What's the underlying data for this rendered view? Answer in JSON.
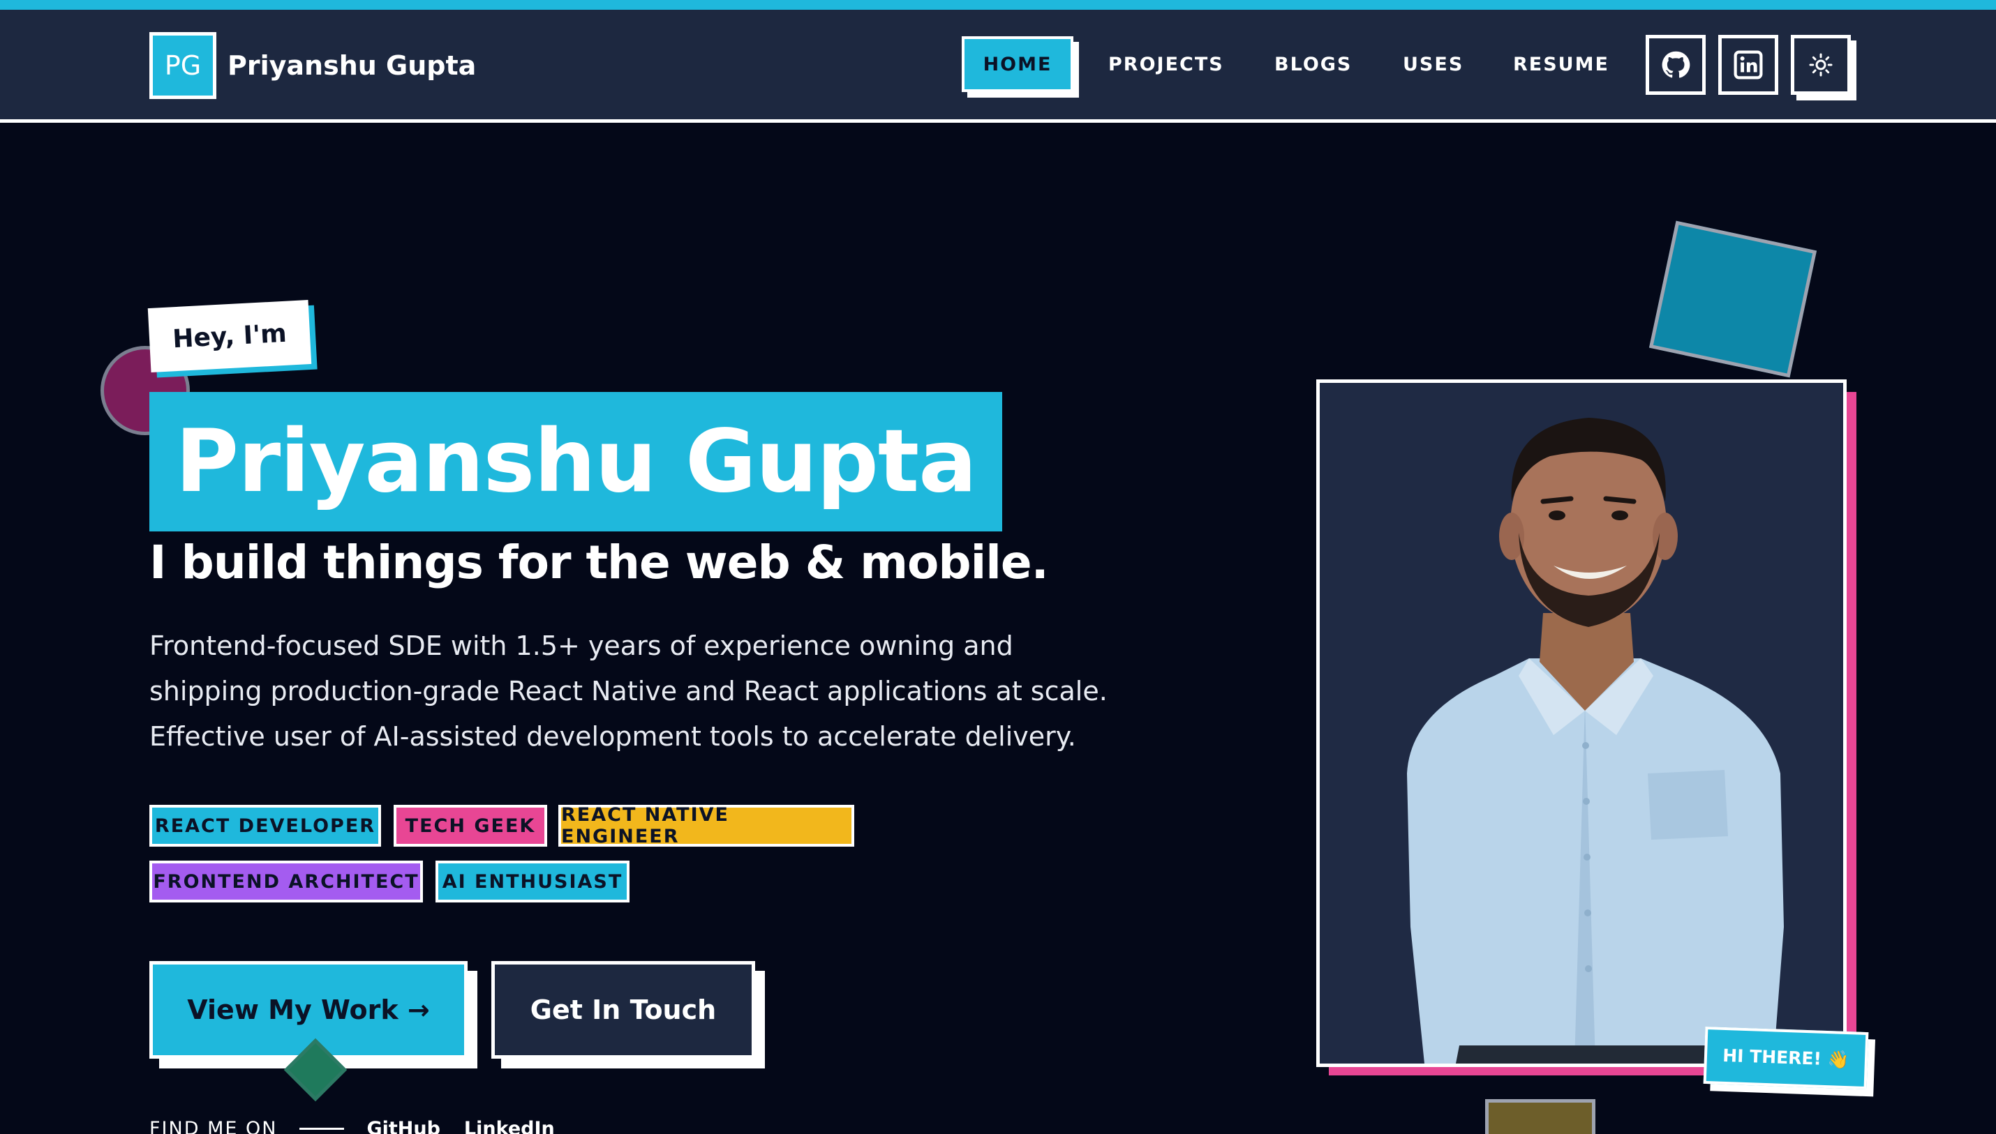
{
  "brand": {
    "initials": "PG",
    "name": "Priyanshu Gupta"
  },
  "nav": {
    "home": "HOME",
    "projects": "PROJECTS",
    "blogs": "BLOGS",
    "uses": "USES",
    "resume": "RESUME"
  },
  "header_icons": {
    "github": "github-icon",
    "linkedin": "linkedin-icon",
    "theme": "sun-icon"
  },
  "hero": {
    "greeting": "Hey, I'm",
    "name": "Priyanshu Gupta",
    "tagline": "I build things for the web & mobile.",
    "description": [
      "Frontend-focused SDE with 1.5+ years of experience owning and",
      "shipping production-grade React Native and React applications at scale.",
      "Effective user of AI-assisted development tools to accelerate delivery."
    ],
    "chips": [
      {
        "label": "REACT DEVELOPER",
        "color": "#1fb8dc"
      },
      {
        "label": "TECH GEEK",
        "color": "#e84694"
      },
      {
        "label": "REACT NATIVE ENGINEER",
        "color": "#f2b71c"
      },
      {
        "label": "FRONTEND ARCHITECT",
        "color": "#a45cf0"
      },
      {
        "label": "AI ENTHUSIAST",
        "color": "#1fb8dc"
      }
    ],
    "primary_cta": "View My Work →",
    "secondary_cta": "Get In Touch",
    "find_me_label": "FIND ME ON",
    "social_links": [
      "GitHub",
      "LinkedIn"
    ]
  },
  "photo": {
    "badge": "HI THERE! 👋"
  },
  "colors": {
    "accent": "#1fb8dc",
    "pink": "#e84694",
    "yellow": "#f2b71c",
    "purple": "#a45cf0",
    "background": "#040818",
    "header": "#1d2840"
  }
}
